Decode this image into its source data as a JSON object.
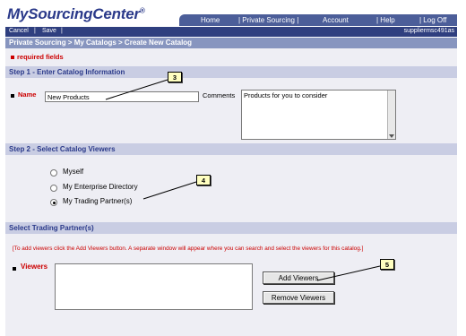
{
  "app": {
    "logo": "MySourcingCenter",
    "logo_mark": "®"
  },
  "topnav": {
    "home": "Home",
    "private_sourcing": "| Private Sourcing |",
    "account": "Account",
    "help": "| Help",
    "logout": "| Log Off"
  },
  "subbar": {
    "cancel": "Cancel",
    "sep": "|",
    "save": "Save",
    "sep2": "|",
    "user": "suppliermsc491as"
  },
  "breadcrumb": "Private Sourcing > My Catalogs > Create New Catalog",
  "required_label": "required fields",
  "step1": {
    "title": "Step 1 - Enter Catalog Information",
    "name_label": "Name",
    "name_value": "New Products",
    "comments_label": "Comments",
    "comments_value": "Products for you to consider"
  },
  "step2": {
    "title": "Step 2 - Select Catalog Viewers",
    "options": [
      "Myself",
      "My Enterprise Directory",
      "My Trading Partner(s)"
    ],
    "selected": "My Trading Partner(s)"
  },
  "partners": {
    "title": "Select Trading Partner(s)",
    "instructions": "[To add viewers click the Add Viewers button. A separate window will appear where you can search and select the viewers for this catalog.]",
    "viewers_label": "Viewers",
    "add_button": "Add Viewers",
    "remove_button": "Remove Viewers"
  },
  "callouts": {
    "c3": "3",
    "c4": "4",
    "c5": "5"
  },
  "colors": {
    "brand": "#2b3a8a",
    "nav": "#4c5e99",
    "required": "#cc0000",
    "section": "#c9cde3",
    "callout": "#ffffc0"
  }
}
